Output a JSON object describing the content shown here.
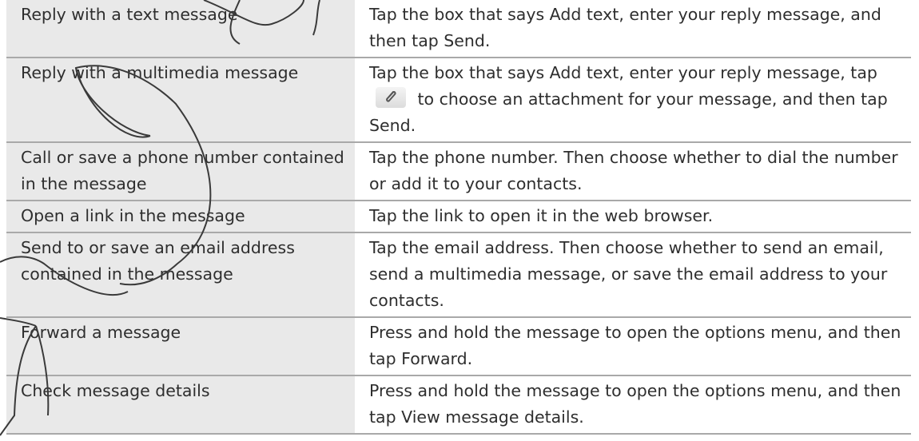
{
  "rows": [
    {
      "action": "Reply with a text message",
      "desc": [
        {
          "t": "Tap the box that says "
        },
        {
          "t": "Add text",
          "ui": true
        },
        {
          "t": ", enter your reply message, and then tap "
        },
        {
          "t": "Send",
          "ui": true
        },
        {
          "t": "."
        }
      ]
    },
    {
      "action": "Reply with a multimedia message",
      "desc": [
        {
          "t": "Tap the box that says "
        },
        {
          "t": "Add text",
          "ui": true
        },
        {
          "t": ", enter your reply message, tap "
        },
        {
          "icon": "paperclip-icon"
        },
        {
          "t": " to choose an attachment for your message, and then tap "
        },
        {
          "t": "Send",
          "ui": true
        },
        {
          "t": "."
        }
      ]
    },
    {
      "action": "Call or save a phone number contained in the message",
      "desc": [
        {
          "t": "Tap the phone number. Then choose whether to dial the number or add it to your contacts."
        }
      ]
    },
    {
      "action": "Open a link in the message",
      "desc": [
        {
          "t": "Tap the link to open it in the web browser."
        }
      ]
    },
    {
      "action": "Send to or save an email address contained in the message",
      "desc": [
        {
          "t": "Tap the email address. Then choose whether to send an email, send a multimedia message, or save the email address to your contacts."
        }
      ]
    },
    {
      "action": "Forward a message",
      "desc": [
        {
          "t": "Press and hold the message to open the options menu, and then tap "
        },
        {
          "t": "Forward",
          "ui": true
        },
        {
          "t": "."
        }
      ]
    },
    {
      "action": "Check message details",
      "desc": [
        {
          "t": "Press and hold the message to open the options menu, and then tap "
        },
        {
          "t": "View message details",
          "ui": true
        },
        {
          "t": "."
        }
      ]
    }
  ],
  "colors": {
    "action_column_bg": "#e9e9e9",
    "row_divider": "#a9a9a9",
    "text": "#2e2e2e"
  }
}
